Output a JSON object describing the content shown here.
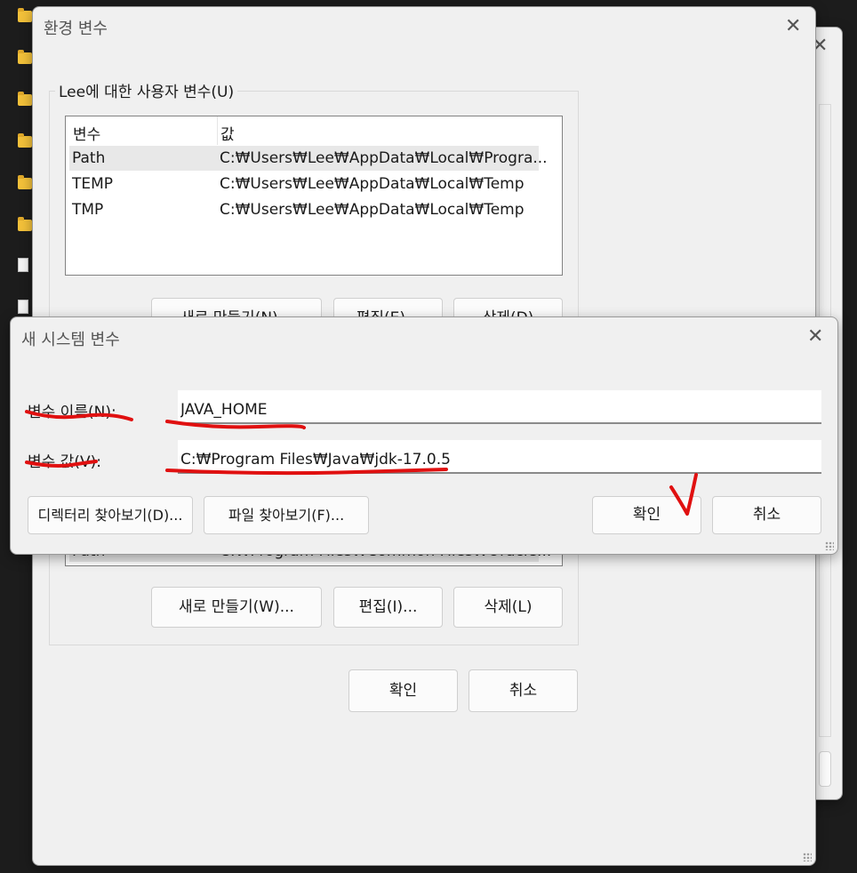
{
  "env_dialog": {
    "title": "환경 변수",
    "user_group_label": "Lee에 대한 사용자 변수(U)",
    "columns": [
      "변수",
      "값"
    ],
    "rows": [
      {
        "name": "Path",
        "value": "C:₩Users₩Lee₩AppData₩Local₩Progra..."
      },
      {
        "name": "TEMP",
        "value": "C:₩Users₩Lee₩AppData₩Local₩Temp"
      },
      {
        "name": "TMP",
        "value": "C:₩Users₩Lee₩AppData₩Local₩Temp"
      }
    ],
    "user_buttons": {
      "new": "새로 만들기(N)...",
      "edit": "편집(E)...",
      "delete": "삭제(D)"
    },
    "system_row": {
      "name": "Path",
      "value": "C:₩Program Files₩Common Files₩Oracle..."
    },
    "system_buttons": {
      "new": "새로 만들기(W)...",
      "edit": "편집(I)...",
      "delete": "삭제(L)"
    },
    "ok": "확인",
    "cancel": "취소"
  },
  "new_var_dialog": {
    "title": "새 시스템 변수",
    "name_label": "변수 이름(N):",
    "name_value": "JAVA_HOME",
    "value_label": "변수 값(V):",
    "value_value": "C:₩Program Files₩Java₩jdk-17.0.5",
    "browse_dir": "디렉터리 찾아보기(D)...",
    "browse_file": "파일 찾아보기(F)...",
    "ok": "확인",
    "cancel": "취소"
  },
  "colors": {
    "annotation": "#e01010"
  },
  "icons": {
    "close": "close-icon"
  }
}
